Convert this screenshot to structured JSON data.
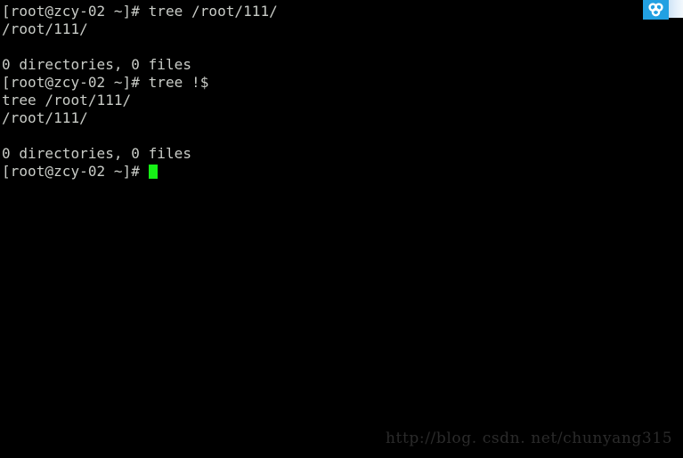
{
  "terminal": {
    "background_color": "#000000",
    "text_color": "#c9ccc7",
    "cursor_color": "#16f016",
    "lines": [
      {
        "text": "[root@zcy-02 ~]# tree /root/111/"
      },
      {
        "text": "/root/111/"
      },
      {
        "text": ""
      },
      {
        "text": "0 directories, 0 files"
      },
      {
        "text": "[root@zcy-02 ~]# tree !$"
      },
      {
        "text": "tree /root/111/"
      },
      {
        "text": "/root/111/"
      },
      {
        "text": ""
      },
      {
        "text": "0 directories, 0 files"
      }
    ],
    "active_prompt": "[root@zcy-02 ~]# ",
    "cursor_glyph": "block-cursor"
  },
  "corner_widget": {
    "icon_name": "trefoil-cloud-icon",
    "blue_color": "#22a0e2",
    "strip_color": "#dce9f5"
  },
  "watermark": {
    "text": "http://blog. csdn. net/chunyang315",
    "color": "#2b2b2b"
  }
}
